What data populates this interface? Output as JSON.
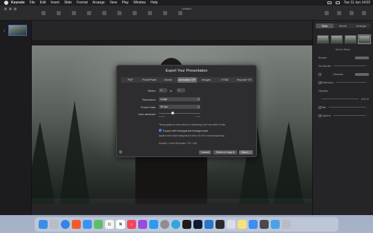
{
  "menubar": {
    "items": [
      "Keynote",
      "File",
      "Edit",
      "Insert",
      "Slide",
      "Format",
      "Arrange",
      "View",
      "Play",
      "Window",
      "Help"
    ],
    "clock": "Tue 11 Jun  14:02"
  },
  "window": {
    "title": "Untitled",
    "navigator": {
      "slide_number": "1"
    }
  },
  "inspector": {
    "tabs": [
      "Slide",
      "Movie",
      "Arrange"
    ],
    "active_tab": "Slide",
    "slide_layout_label": "Movie Basic",
    "rows": [
      "Border",
      "No Border",
      "Shadow",
      "Reflection",
      "Opacity",
      "Title",
      "Caption"
    ],
    "opacity_value": "100 %"
  },
  "dialog": {
    "title": "Export Your Presentation",
    "format_tabs": [
      "PDF",
      "PowerPoint",
      "Movie",
      "Animated GIF",
      "Images",
      "HTML",
      "Keynote '09"
    ],
    "active_tab": "Animated GIF",
    "slides_label": "Slides:",
    "slides_from": "1",
    "slides_to_label": "to",
    "slides_to": "1",
    "resolution_label": "Resolution:",
    "resolution_value": "Large",
    "frame_rate_label": "Frame Rate:",
    "frame_rate_value": "30 fps",
    "auto_advance_label": "Auto-advance:",
    "slider_min": "0 secs",
    "slider_max": "1 sec",
    "timing_note": "Timing applies to click events for advancing to the next slide or build.",
    "transparent_label": "Export with transparent backgrounds",
    "transparent_checked": true,
    "transparent_note": "Applies when slide background is set to No Fill or has transparency.",
    "duration_text": "Duration: 4 secs     Resolution: 720 × 405",
    "help_label": "?",
    "cancel_label": "Cancel",
    "send_copy_label": "Send a Copy ▾",
    "save_label": "Save…"
  },
  "dock": {
    "apps": [
      "finder",
      "launchpad",
      "safari",
      "brave",
      "mail",
      "maps",
      "calendar",
      "notion",
      "music",
      "podcasts",
      "app-store",
      "settings",
      "telegram",
      "terminal",
      "photoshop",
      "vscode",
      "console",
      "preview",
      "notes",
      "keynote",
      "scripts",
      "downloads",
      "trash"
    ],
    "calendar_day": "11"
  }
}
